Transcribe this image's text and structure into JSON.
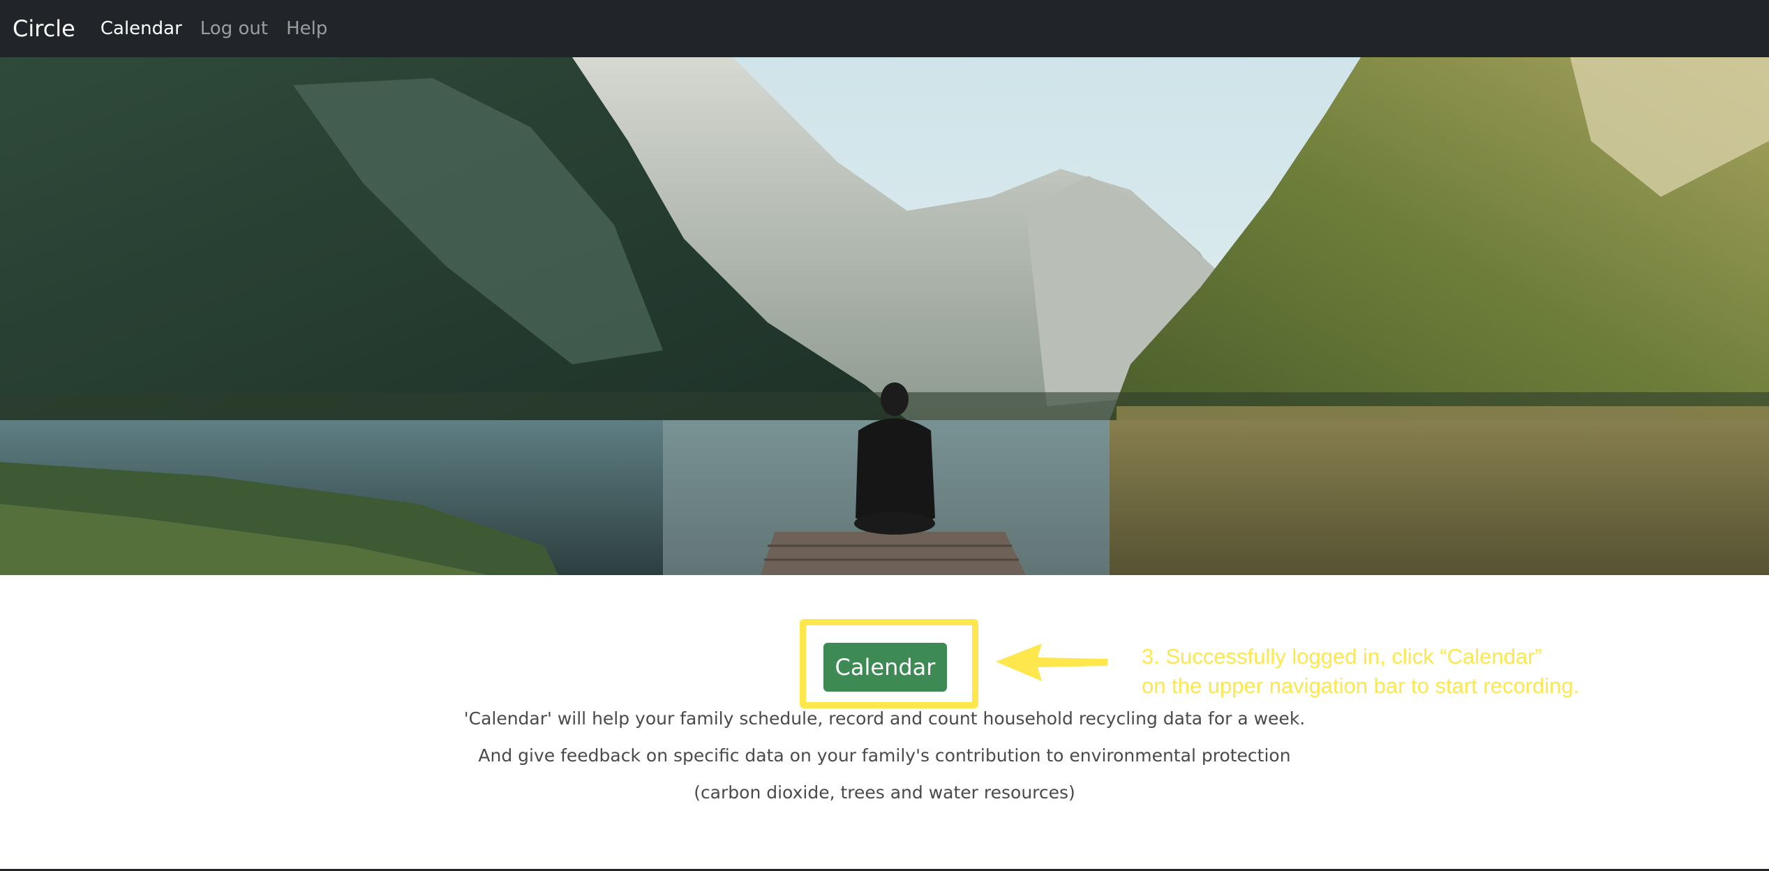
{
  "navbar": {
    "brand": "Circle",
    "links": [
      {
        "label": "Calendar",
        "active": true
      },
      {
        "label": "Log out",
        "active": false
      },
      {
        "label": "Help",
        "active": false
      }
    ]
  },
  "main": {
    "button_label": "Calendar",
    "description": [
      "'Calendar' will help your family schedule, record and count household recycling data for a week.",
      "And give feedback on specific data on your family's contribution to environmental protection",
      "(carbon dioxide, trees and water resources)"
    ]
  },
  "annotation": {
    "lines": [
      "3. Successfully logged in, click “Calendar”",
      "on the upper navigation bar to start recording."
    ],
    "color": "#fde74c"
  },
  "colors": {
    "navbar_bg": "#212529",
    "button_bg": "#3e8a55",
    "highlight": "#fde74c"
  }
}
